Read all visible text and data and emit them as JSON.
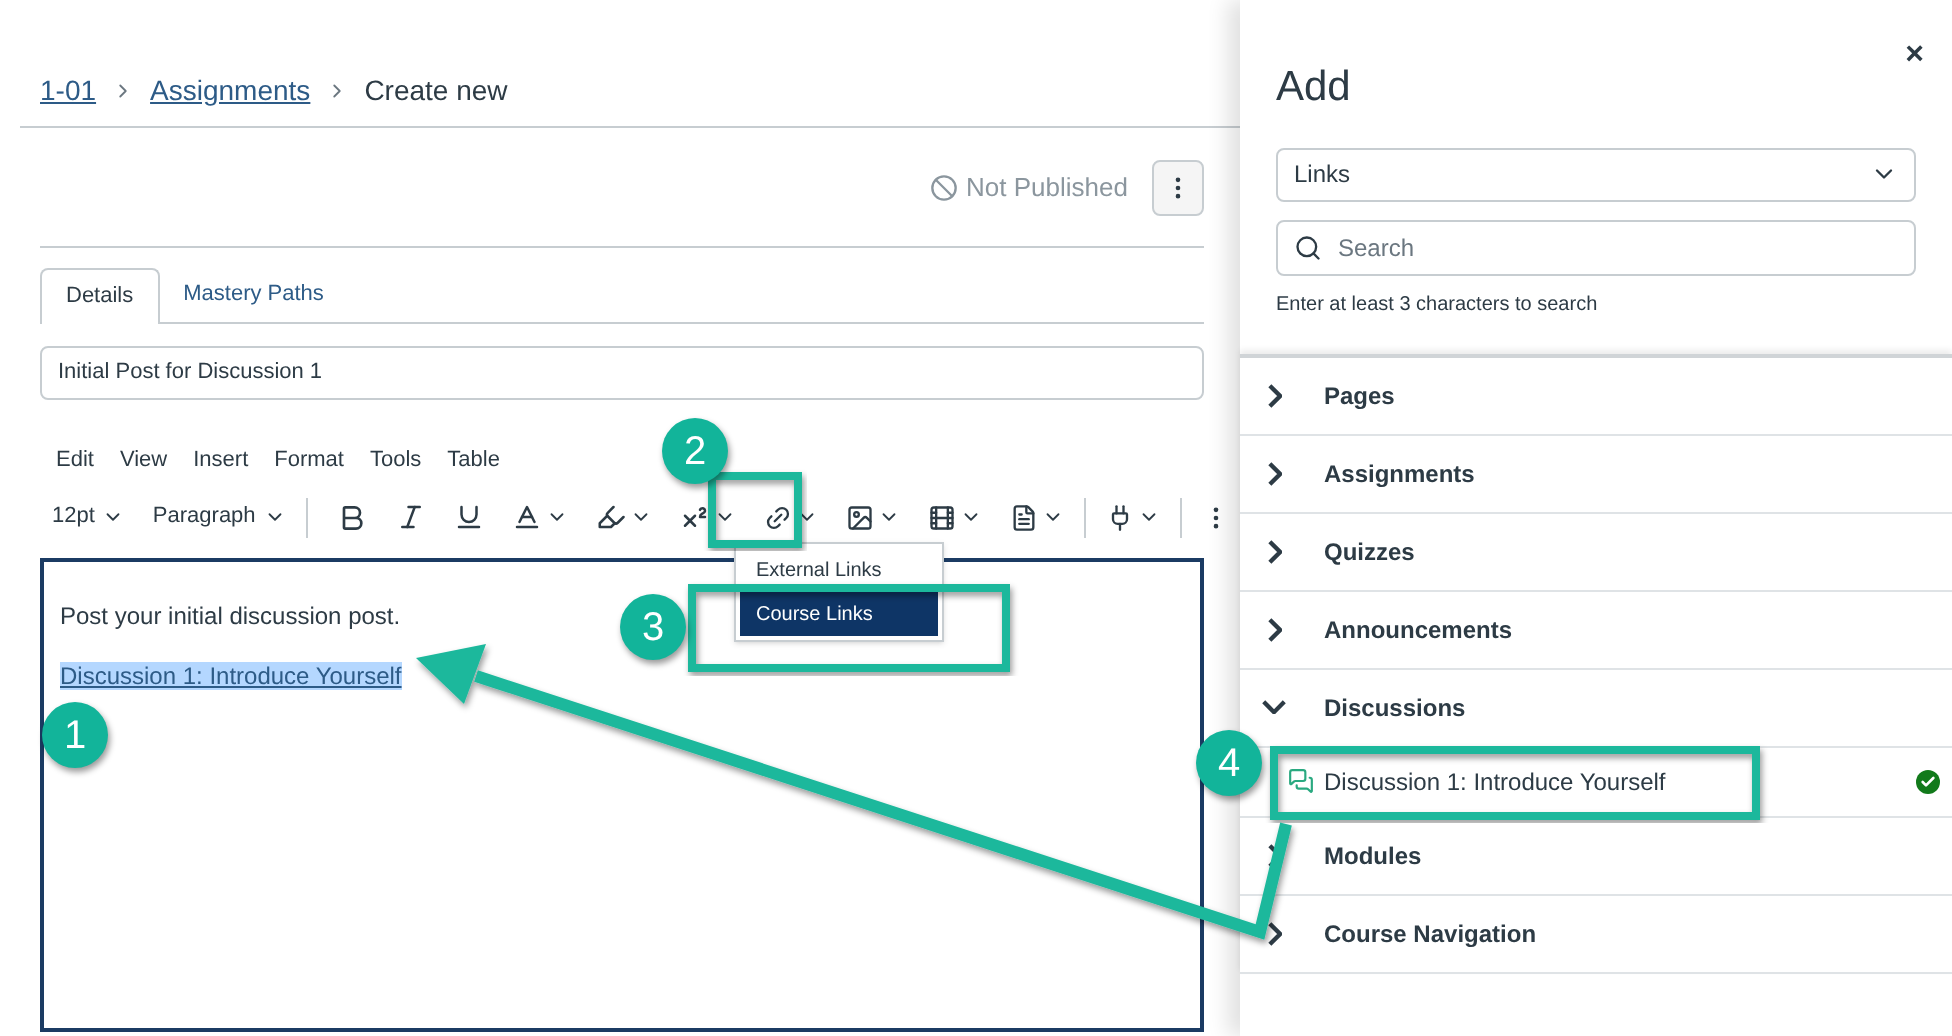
{
  "breadcrumb": [
    {
      "text": "1-01",
      "link": true
    },
    {
      "text": "Assignments",
      "link": true
    },
    {
      "text": "Create new",
      "link": false
    }
  ],
  "status": "Not Published",
  "tabs": [
    {
      "label": "Details",
      "selected": true
    },
    {
      "label": "Mastery Paths",
      "selected": false
    }
  ],
  "title_field": {
    "value": "Initial Post for Discussion 1"
  },
  "menu": [
    "Edit",
    "View",
    "Insert",
    "Format",
    "Tools",
    "Table"
  ],
  "toolbar": {
    "font_size": "12pt",
    "block": "Paragraph"
  },
  "link_menu": [
    {
      "label": "External Links",
      "selected": false
    },
    {
      "label": "Course Links",
      "selected": true
    }
  ],
  "editor": {
    "paragraph": "Post your initial discussion post.",
    "link": {
      "text": "Discussion 1: Introduce Yourself",
      "highlighted": true
    }
  },
  "panel": {
    "title": "Add",
    "close": "×",
    "select": "Links",
    "search_placeholder": "Search",
    "hint": "Enter at least 3 characters to search",
    "sections": [
      {
        "label": "Pages",
        "expanded": false
      },
      {
        "label": "Assignments",
        "expanded": false
      },
      {
        "label": "Quizzes",
        "expanded": false
      },
      {
        "label": "Announcements",
        "expanded": false
      },
      {
        "label": "Discussions",
        "expanded": true,
        "children": [
          {
            "label": "Discussion 1: Introduce Yourself",
            "published": true
          }
        ]
      },
      {
        "label": "Modules",
        "expanded": false
      },
      {
        "label": "Course Navigation",
        "expanded": false
      }
    ]
  },
  "annotations": [
    "1",
    "2",
    "3",
    "4"
  ]
}
